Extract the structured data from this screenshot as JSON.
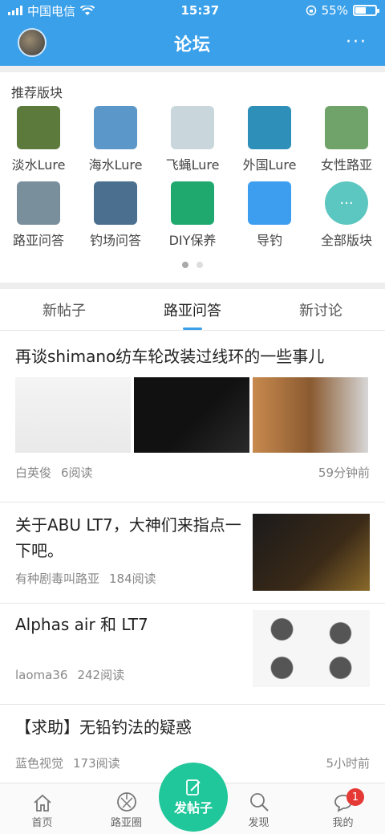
{
  "status_bar": {
    "carrier": "中国电信",
    "time": "15:37",
    "battery": "55%",
    "battery_level": 0.55
  },
  "header": {
    "title": "论坛",
    "more": "···"
  },
  "boards": {
    "title": "推荐版块",
    "items": [
      {
        "label": "淡水Lure",
        "color": "#5b7a3c"
      },
      {
        "label": "海水Lure",
        "color": "#5b97c8"
      },
      {
        "label": "飞蝇Lure",
        "color": "#c9d6dc"
      },
      {
        "label": "外国Lure",
        "color": "#2e8fb8"
      },
      {
        "label": "女性路亚",
        "color": "#6fa36a"
      },
      {
        "label": "路亚问答",
        "color": "#7a8f9c"
      },
      {
        "label": "钓场问答",
        "color": "#4b6f8e"
      },
      {
        "label": "DIY保养",
        "color": "#1fa96f"
      },
      {
        "label": "导钓",
        "color": "#3d9ef0"
      },
      {
        "label": "全部版块",
        "color": "#5cc6c0",
        "icon": "more-icon"
      }
    ],
    "pager_dots": 2,
    "pager_active": 0
  },
  "tabs": [
    "新帖子",
    "路亚问答",
    "新讨论"
  ],
  "active_tab": 1,
  "posts": [
    {
      "title": "再谈shimano纺车轮改装过线环的一些事儿",
      "author": "白英俊",
      "reads": "6阅读",
      "time": "59分钟前"
    },
    {
      "title": "关于ABU LT7，大神们来指点一下吧。",
      "author": "有种剧毒叫路亚",
      "reads": "184阅读"
    },
    {
      "title": "Alphas air 和 LT7",
      "author": "laoma36",
      "reads": "242阅读"
    },
    {
      "title": "【求助】无铅钓法的疑惑",
      "author": "蓝色视觉",
      "reads": "173阅读",
      "time": "5小时前"
    }
  ],
  "tabbar": {
    "items": [
      "首页",
      "路亚圈",
      "发现",
      "我的"
    ],
    "fab": "发帖子",
    "badge": "1"
  },
  "colors": {
    "primary": "#3aa0ea",
    "fab": "#20c79a",
    "badge": "#e53935"
  }
}
